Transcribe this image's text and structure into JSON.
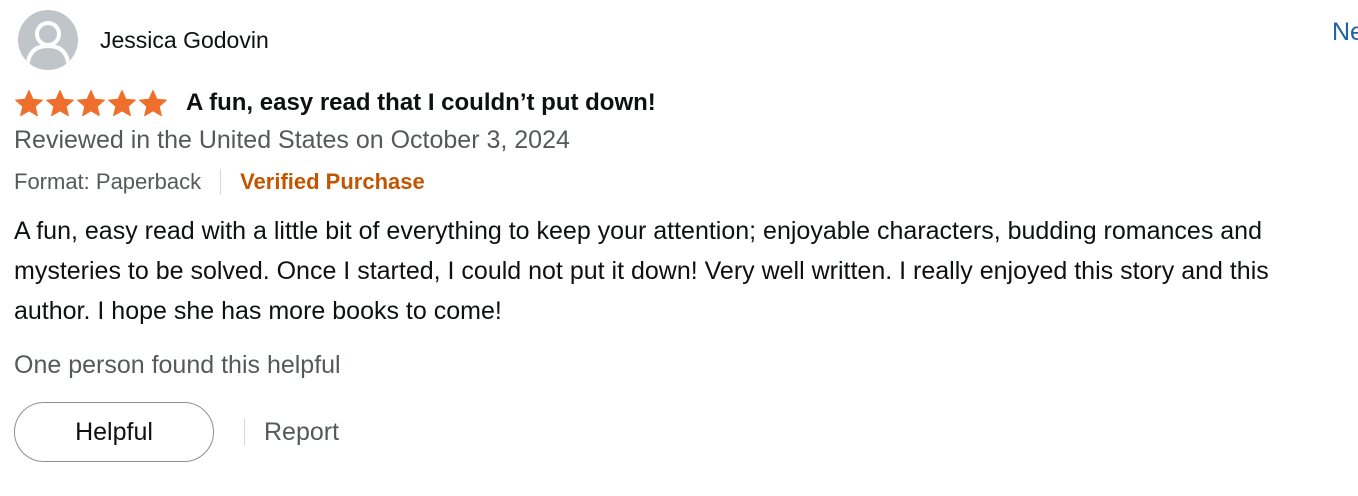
{
  "reviewer": {
    "name": "Jessica Godovin",
    "avatar_icon": "default-user-avatar-icon"
  },
  "review": {
    "rating": 5,
    "rating_max": 5,
    "star_icon": "star-icon",
    "star_color": "#f06e2b",
    "title": "A fun, easy read that I couldn’t put down!",
    "date_line": "Reviewed in the United States on October 3, 2024",
    "format": "Format: Paperback",
    "verified": "Verified Purchase",
    "verified_color": "#c45500",
    "body": "A fun, easy read with a little bit of everything to keep your attention; enjoyable characters, budding romances and mysteries to be solved. Once I started, I could not put it down! Very well written. I really enjoyed this story and this author. I hope she has more books to come!",
    "helpful_count": "One person found this helpful"
  },
  "actions": {
    "helpful_label": "Helpful",
    "report_label": "Report"
  },
  "edge": {
    "link_text": "Ne",
    "link_color": "#2162a1"
  }
}
